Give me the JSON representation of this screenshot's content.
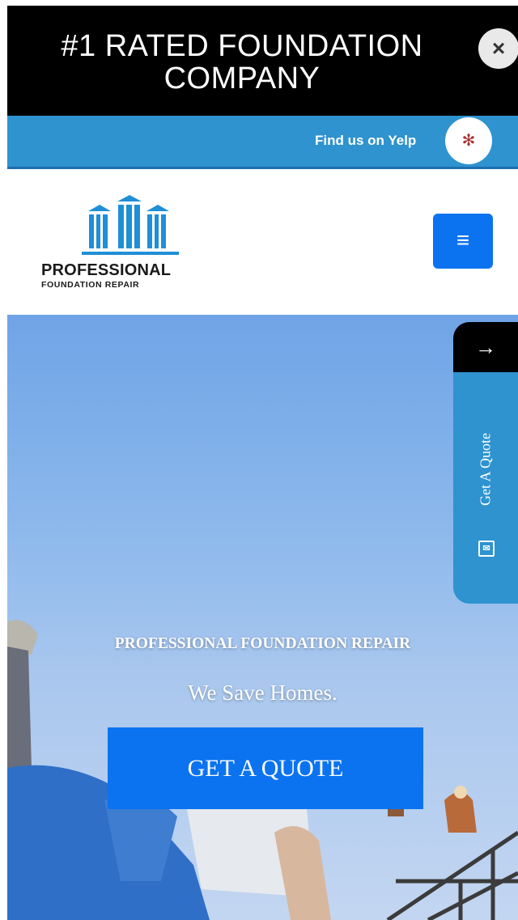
{
  "promo": {
    "title": "#1 RATED FOUNDATION COMPANY",
    "close_icon": "×"
  },
  "yelp": {
    "text": "Find us on Yelp",
    "icon": "yelp-icon"
  },
  "header": {
    "logo_line1": "PROFESSIONAL",
    "logo_line2": "FOUNDATION REPAIR",
    "menu_icon": "≡"
  },
  "hero": {
    "heading": "PROFESSIONAL FOUNDATION REPAIR",
    "subheading": "We Save Homes.",
    "cta": "GET A QUOTE"
  },
  "side_tab": {
    "arrow": "→",
    "label": "Get A Quote"
  },
  "colors": {
    "accent": "#0b73f0",
    "yelp_bar": "#2e93cf",
    "promo_bg": "#000000"
  }
}
